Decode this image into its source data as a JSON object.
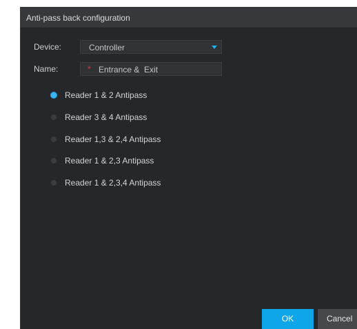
{
  "dialog": {
    "title": "Anti-pass back configuration"
  },
  "device": {
    "label": "Device:",
    "value": "Controller"
  },
  "name": {
    "label": "Name:",
    "required_mark": "*",
    "value": "Entrance &  Exit"
  },
  "options": [
    {
      "label": "Reader 1 & 2 Antipass",
      "selected": true
    },
    {
      "label": "Reader 3 & 4 Antipass",
      "selected": false
    },
    {
      "label": "Reader 1,3 & 2,4 Antipass",
      "selected": false
    },
    {
      "label": "Reader 1 & 2,3 Antipass",
      "selected": false
    },
    {
      "label": "Reader 1 & 2,3,4 Antipass",
      "selected": false
    }
  ],
  "buttons": {
    "ok": "OK",
    "cancel": "Cancel"
  },
  "colors": {
    "accent": "#0ea5e9",
    "background": "#25272b",
    "title_bar": "#36383c",
    "required": "#e03a3a"
  }
}
